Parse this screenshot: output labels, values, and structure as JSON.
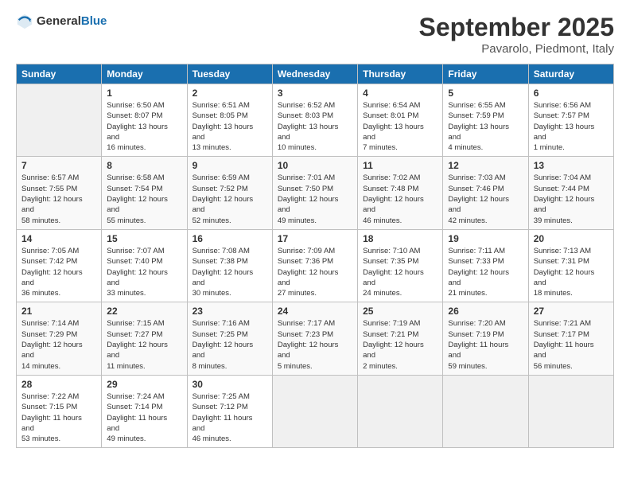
{
  "logo": {
    "general": "General",
    "blue": "Blue"
  },
  "title": "September 2025",
  "subtitle": "Pavarolo, Piedmont, Italy",
  "days_header": [
    "Sunday",
    "Monday",
    "Tuesday",
    "Wednesday",
    "Thursday",
    "Friday",
    "Saturday"
  ],
  "weeks": [
    [
      {
        "day": "",
        "sunrise": "",
        "sunset": "",
        "daylight": ""
      },
      {
        "day": "1",
        "sunrise": "Sunrise: 6:50 AM",
        "sunset": "Sunset: 8:07 PM",
        "daylight": "Daylight: 13 hours and 16 minutes."
      },
      {
        "day": "2",
        "sunrise": "Sunrise: 6:51 AM",
        "sunset": "Sunset: 8:05 PM",
        "daylight": "Daylight: 13 hours and 13 minutes."
      },
      {
        "day": "3",
        "sunrise": "Sunrise: 6:52 AM",
        "sunset": "Sunset: 8:03 PM",
        "daylight": "Daylight: 13 hours and 10 minutes."
      },
      {
        "day": "4",
        "sunrise": "Sunrise: 6:54 AM",
        "sunset": "Sunset: 8:01 PM",
        "daylight": "Daylight: 13 hours and 7 minutes."
      },
      {
        "day": "5",
        "sunrise": "Sunrise: 6:55 AM",
        "sunset": "Sunset: 7:59 PM",
        "daylight": "Daylight: 13 hours and 4 minutes."
      },
      {
        "day": "6",
        "sunrise": "Sunrise: 6:56 AM",
        "sunset": "Sunset: 7:57 PM",
        "daylight": "Daylight: 13 hours and 1 minute."
      }
    ],
    [
      {
        "day": "7",
        "sunrise": "Sunrise: 6:57 AM",
        "sunset": "Sunset: 7:55 PM",
        "daylight": "Daylight: 12 hours and 58 minutes."
      },
      {
        "day": "8",
        "sunrise": "Sunrise: 6:58 AM",
        "sunset": "Sunset: 7:54 PM",
        "daylight": "Daylight: 12 hours and 55 minutes."
      },
      {
        "day": "9",
        "sunrise": "Sunrise: 6:59 AM",
        "sunset": "Sunset: 7:52 PM",
        "daylight": "Daylight: 12 hours and 52 minutes."
      },
      {
        "day": "10",
        "sunrise": "Sunrise: 7:01 AM",
        "sunset": "Sunset: 7:50 PM",
        "daylight": "Daylight: 12 hours and 49 minutes."
      },
      {
        "day": "11",
        "sunrise": "Sunrise: 7:02 AM",
        "sunset": "Sunset: 7:48 PM",
        "daylight": "Daylight: 12 hours and 46 minutes."
      },
      {
        "day": "12",
        "sunrise": "Sunrise: 7:03 AM",
        "sunset": "Sunset: 7:46 PM",
        "daylight": "Daylight: 12 hours and 42 minutes."
      },
      {
        "day": "13",
        "sunrise": "Sunrise: 7:04 AM",
        "sunset": "Sunset: 7:44 PM",
        "daylight": "Daylight: 12 hours and 39 minutes."
      }
    ],
    [
      {
        "day": "14",
        "sunrise": "Sunrise: 7:05 AM",
        "sunset": "Sunset: 7:42 PM",
        "daylight": "Daylight: 12 hours and 36 minutes."
      },
      {
        "day": "15",
        "sunrise": "Sunrise: 7:07 AM",
        "sunset": "Sunset: 7:40 PM",
        "daylight": "Daylight: 12 hours and 33 minutes."
      },
      {
        "day": "16",
        "sunrise": "Sunrise: 7:08 AM",
        "sunset": "Sunset: 7:38 PM",
        "daylight": "Daylight: 12 hours and 30 minutes."
      },
      {
        "day": "17",
        "sunrise": "Sunrise: 7:09 AM",
        "sunset": "Sunset: 7:36 PM",
        "daylight": "Daylight: 12 hours and 27 minutes."
      },
      {
        "day": "18",
        "sunrise": "Sunrise: 7:10 AM",
        "sunset": "Sunset: 7:35 PM",
        "daylight": "Daylight: 12 hours and 24 minutes."
      },
      {
        "day": "19",
        "sunrise": "Sunrise: 7:11 AM",
        "sunset": "Sunset: 7:33 PM",
        "daylight": "Daylight: 12 hours and 21 minutes."
      },
      {
        "day": "20",
        "sunrise": "Sunrise: 7:13 AM",
        "sunset": "Sunset: 7:31 PM",
        "daylight": "Daylight: 12 hours and 18 minutes."
      }
    ],
    [
      {
        "day": "21",
        "sunrise": "Sunrise: 7:14 AM",
        "sunset": "Sunset: 7:29 PM",
        "daylight": "Daylight: 12 hours and 14 minutes."
      },
      {
        "day": "22",
        "sunrise": "Sunrise: 7:15 AM",
        "sunset": "Sunset: 7:27 PM",
        "daylight": "Daylight: 12 hours and 11 minutes."
      },
      {
        "day": "23",
        "sunrise": "Sunrise: 7:16 AM",
        "sunset": "Sunset: 7:25 PM",
        "daylight": "Daylight: 12 hours and 8 minutes."
      },
      {
        "day": "24",
        "sunrise": "Sunrise: 7:17 AM",
        "sunset": "Sunset: 7:23 PM",
        "daylight": "Daylight: 12 hours and 5 minutes."
      },
      {
        "day": "25",
        "sunrise": "Sunrise: 7:19 AM",
        "sunset": "Sunset: 7:21 PM",
        "daylight": "Daylight: 12 hours and 2 minutes."
      },
      {
        "day": "26",
        "sunrise": "Sunrise: 7:20 AM",
        "sunset": "Sunset: 7:19 PM",
        "daylight": "Daylight: 11 hours and 59 minutes."
      },
      {
        "day": "27",
        "sunrise": "Sunrise: 7:21 AM",
        "sunset": "Sunset: 7:17 PM",
        "daylight": "Daylight: 11 hours and 56 minutes."
      }
    ],
    [
      {
        "day": "28",
        "sunrise": "Sunrise: 7:22 AM",
        "sunset": "Sunset: 7:15 PM",
        "daylight": "Daylight: 11 hours and 53 minutes."
      },
      {
        "day": "29",
        "sunrise": "Sunrise: 7:24 AM",
        "sunset": "Sunset: 7:14 PM",
        "daylight": "Daylight: 11 hours and 49 minutes."
      },
      {
        "day": "30",
        "sunrise": "Sunrise: 7:25 AM",
        "sunset": "Sunset: 7:12 PM",
        "daylight": "Daylight: 11 hours and 46 minutes."
      },
      {
        "day": "",
        "sunrise": "",
        "sunset": "",
        "daylight": ""
      },
      {
        "day": "",
        "sunrise": "",
        "sunset": "",
        "daylight": ""
      },
      {
        "day": "",
        "sunrise": "",
        "sunset": "",
        "daylight": ""
      },
      {
        "day": "",
        "sunrise": "",
        "sunset": "",
        "daylight": ""
      }
    ]
  ]
}
